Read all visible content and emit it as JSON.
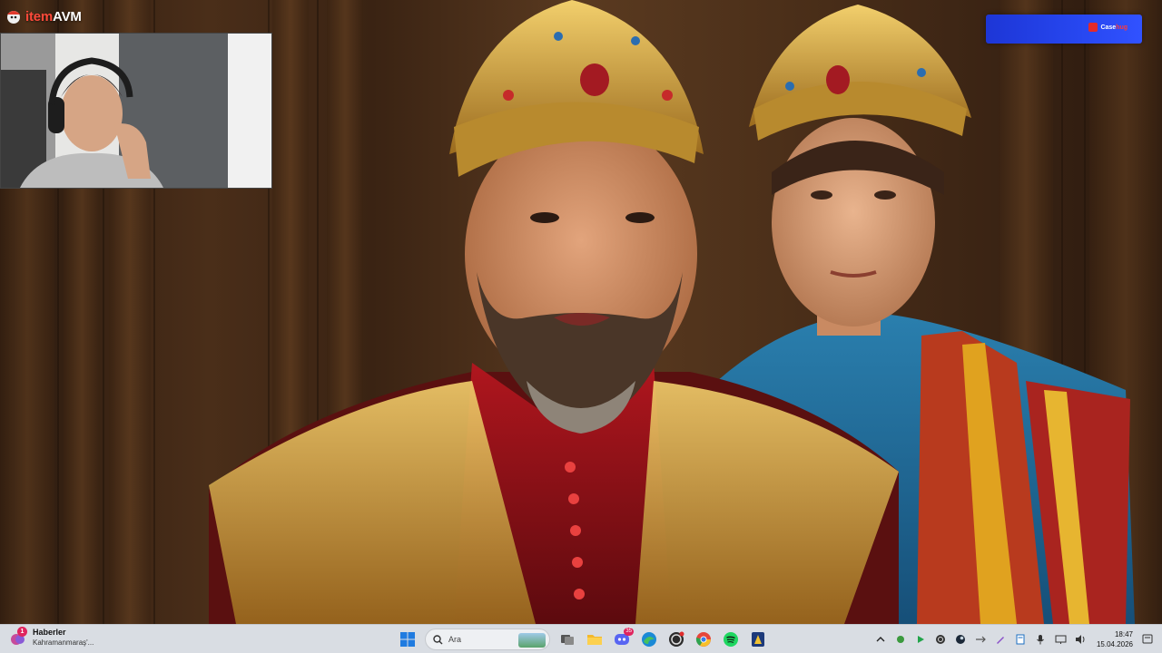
{
  "overlay": {
    "brand_name": "itemAVM",
    "brand_name_part1": "item",
    "brand_name_part2": "AVM",
    "sponsor_name": "Casehug",
    "sponsor_part1": "Case",
    "sponsor_part2": "hug"
  },
  "taskbar": {
    "widget_title": "Haberler",
    "widget_subtitle": "Kahramanmaraş'...",
    "widget_badge": "1",
    "search_placeholder": "Ara",
    "apps": [
      "start-icon",
      "search",
      "task-view-icon",
      "file-explorer-icon",
      "discord-icon",
      "edge-icon",
      "obs-icon",
      "chrome-icon",
      "spotify-icon",
      "app-icon"
    ],
    "discord_badge": "35",
    "time": "18:47",
    "date": "15.04.2026"
  },
  "colors": {
    "brand_accent": "#ff4a3a",
    "sponsor_bg": "#2747f0",
    "taskbar_bg": "#d9dde3"
  }
}
